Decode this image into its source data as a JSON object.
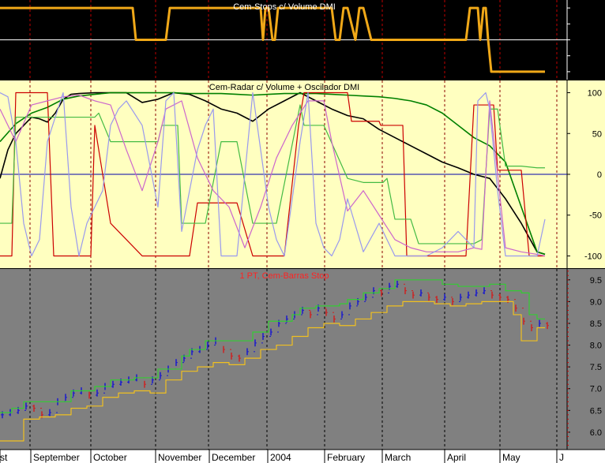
{
  "chart_data": [
    {
      "type": "line",
      "title": "Cem-Stops c/ Volume DMI",
      "ylim": [
        -1.25,
        1.25
      ],
      "yticks": [
        "1.0",
        "0.5",
        "0.0",
        "-0.5",
        "-1.0"
      ],
      "background": "#000000",
      "series": [
        {
          "color": "#f0a818",
          "x": [
            0,
            20,
            40,
            60,
            80,
            100,
            120,
            140,
            160,
            168,
            172,
            176,
            200,
            210,
            215,
            220,
            240,
            260,
            280,
            300,
            320,
            330,
            333,
            336,
            340,
            345,
            348,
            352,
            355,
            360,
            380,
            400,
            415,
            420,
            425,
            430,
            435,
            440,
            450,
            455,
            460,
            470,
            480,
            500,
            520,
            540,
            560,
            580,
            590,
            595,
            600,
            605,
            608,
            612,
            615,
            618,
            622,
            630,
            650,
            670,
            690
          ],
          "values": [
            1,
            1,
            1,
            1,
            1,
            1,
            1,
            1,
            1,
            1,
            0,
            0,
            0,
            0,
            1,
            1,
            1,
            1,
            1,
            1,
            1,
            1,
            0,
            1,
            1,
            0,
            0,
            1,
            1,
            1,
            1,
            1,
            1,
            1,
            0,
            0,
            1,
            1,
            0,
            1,
            1,
            0,
            0,
            0,
            0,
            0,
            0,
            0,
            0,
            1,
            1,
            1,
            0,
            1,
            1,
            0,
            -1,
            -1,
            -1,
            -1,
            -1
          ]
        }
      ]
    },
    {
      "type": "line",
      "title": "Cem-Radar c/ Volume + Oscilador DMI",
      "ylim": [
        -115,
        115
      ],
      "yticks": [
        "100",
        "50",
        "0",
        "-50",
        "-100"
      ],
      "background": "#ffffc0",
      "series": [
        {
          "color": "#000000",
          "x": [
            0,
            10,
            20,
            30,
            40,
            50,
            60,
            70,
            80,
            90,
            100,
            120,
            140,
            160,
            180,
            200,
            220,
            240,
            260,
            280,
            300,
            320,
            340,
            360,
            380,
            400,
            420,
            440,
            460,
            480,
            500,
            520,
            540,
            560,
            580,
            600,
            620,
            640,
            660,
            680,
            690
          ],
          "values": [
            -5,
            30,
            50,
            60,
            70,
            68,
            64,
            75,
            92,
            98,
            99,
            100,
            100,
            100,
            88,
            92,
            100,
            98,
            90,
            80,
            75,
            65,
            80,
            90,
            100,
            90,
            80,
            72,
            68,
            55,
            45,
            35,
            25,
            15,
            8,
            0,
            -5,
            -30,
            -60,
            -95,
            -98
          ]
        },
        {
          "color": "#008000",
          "x": [
            0,
            20,
            40,
            60,
            80,
            100,
            120,
            140,
            160,
            180,
            200,
            220,
            240,
            260,
            280,
            300,
            320,
            340,
            360,
            380,
            400,
            420,
            440,
            460,
            480,
            500,
            520,
            540,
            560,
            580,
            600,
            620,
            640,
            660,
            680,
            690
          ],
          "values": [
            40,
            62,
            75,
            82,
            92,
            96,
            98,
            100,
            100,
            100,
            100,
            100,
            99,
            99,
            99,
            98,
            97,
            98,
            99,
            99,
            99,
            98,
            97,
            96,
            95,
            93,
            90,
            85,
            75,
            60,
            45,
            35,
            15,
            -40,
            -95,
            -98
          ]
        },
        {
          "color": "#cc0000",
          "x": [
            0,
            15,
            20,
            60,
            68,
            115,
            120,
            140,
            180,
            200,
            240,
            250,
            268,
            300,
            320,
            340,
            360,
            378,
            385,
            440,
            445,
            480,
            482,
            510,
            515,
            590,
            600,
            625,
            630,
            660,
            670,
            690
          ],
          "values": [
            -100,
            -100,
            100,
            100,
            -100,
            -100,
            60,
            -60,
            -100,
            -100,
            -100,
            -35,
            -35,
            -35,
            -100,
            -100,
            -100,
            60,
            100,
            100,
            65,
            65,
            60,
            60,
            -100,
            -100,
            85,
            85,
            5,
            5,
            -100,
            -100
          ]
        },
        {
          "color": "#44bb44",
          "x": [
            0,
            15,
            20,
            40,
            60,
            80,
            120,
            125,
            140,
            180,
            200,
            205,
            225,
            230,
            260,
            280,
            300,
            320,
            340,
            350,
            380,
            385,
            410,
            440,
            460,
            480,
            485,
            490,
            500,
            520,
            530,
            600,
            610,
            620,
            630,
            640,
            660,
            680,
            690
          ],
          "values": [
            -60,
            -60,
            70,
            70,
            70,
            70,
            70,
            75,
            40,
            40,
            40,
            60,
            60,
            -60,
            -60,
            40,
            40,
            -60,
            -60,
            -60,
            85,
            60,
            60,
            -5,
            -10,
            -10,
            -10,
            -5,
            -55,
            -55,
            -85,
            -85,
            -80,
            80,
            80,
            10,
            10,
            8,
            8
          ]
        },
        {
          "color": "#cc66cc",
          "x": [
            0,
            10,
            20,
            40,
            60,
            80,
            100,
            120,
            140,
            160,
            180,
            200,
            210,
            230,
            250,
            270,
            290,
            310,
            330,
            350,
            370,
            390,
            410,
            420,
            440,
            460,
            480,
            500,
            520,
            540,
            560,
            580,
            600,
            610,
            620,
            630,
            640,
            660,
            680,
            690
          ],
          "values": [
            80,
            60,
            40,
            85,
            90,
            95,
            97,
            90,
            85,
            30,
            -20,
            40,
            80,
            90,
            20,
            -20,
            -40,
            -90,
            -40,
            20,
            60,
            90,
            90,
            40,
            -45,
            -20,
            -50,
            -80,
            -90,
            -95,
            -95,
            -95,
            -90,
            -92,
            90,
            0,
            -90,
            -95,
            -98,
            -100
          ]
        },
        {
          "color": "#9999ee",
          "x": [
            0,
            10,
            20,
            30,
            40,
            50,
            60,
            70,
            80,
            90,
            100,
            110,
            120,
            130,
            140,
            150,
            160,
            180,
            200,
            210,
            220,
            230,
            240,
            250,
            260,
            270,
            280,
            300,
            320,
            340,
            350,
            360,
            380,
            390,
            400,
            410,
            420,
            430,
            440,
            460,
            480,
            500,
            520,
            540,
            560,
            580,
            600,
            605,
            615,
            620,
            630,
            640,
            660,
            680,
            690
          ],
          "values": [
            100,
            95,
            40,
            -60,
            -100,
            -80,
            40,
            70,
            100,
            -40,
            -100,
            -60,
            -40,
            -20,
            60,
            80,
            90,
            60,
            -40,
            90,
            100,
            -70,
            -20,
            30,
            60,
            80,
            -100,
            -100,
            100,
            -40,
            -80,
            -100,
            40,
            100,
            -60,
            -90,
            -100,
            -80,
            -30,
            -95,
            -60,
            -100,
            -100,
            -100,
            -90,
            -70,
            -90,
            90,
            100,
            80,
            -20,
            -100,
            -100,
            -100,
            -55
          ]
        }
      ]
    },
    {
      "type": "ohlc",
      "title": "1 PT, Cem-Barras Stop",
      "ylim": [
        5.6,
        9.75
      ],
      "yticks": [
        "9.5",
        "9.0",
        "8.5",
        "8.0",
        "7.5",
        "7.0",
        "6.5",
        "6.0"
      ],
      "background": "#808080",
      "xlabels": [
        "st",
        "September",
        "October",
        "November",
        "December",
        "2004",
        "February",
        "March",
        "April",
        "May",
        "J"
      ],
      "series": [
        {
          "name": "price",
          "color": "#1a1acc",
          "down_color": "#cc2222",
          "x": [
            0,
            10,
            20,
            30,
            40,
            50,
            60,
            70,
            80,
            90,
            100,
            110,
            120,
            130,
            140,
            150,
            160,
            170,
            180,
            190,
            200,
            210,
            220,
            230,
            240,
            250,
            260,
            270,
            280,
            290,
            300,
            310,
            320,
            330,
            340,
            350,
            360,
            370,
            380,
            390,
            400,
            410,
            420,
            430,
            440,
            450,
            460,
            470,
            480,
            490,
            500,
            510,
            520,
            530,
            540,
            550,
            560,
            570,
            580,
            590,
            600,
            610,
            620,
            630,
            640,
            650,
            660,
            670,
            680,
            690
          ],
          "values": [
            6.4,
            6.45,
            6.5,
            6.6,
            6.55,
            6.4,
            6.45,
            6.7,
            6.8,
            6.9,
            6.95,
            6.85,
            6.9,
            7.05,
            7.1,
            7.15,
            7.2,
            7.25,
            7.1,
            7.2,
            7.3,
            7.45,
            7.6,
            7.7,
            7.85,
            7.9,
            8.0,
            8.1,
            7.9,
            7.75,
            7.7,
            7.85,
            8.05,
            8.2,
            8.3,
            8.5,
            8.6,
            8.7,
            8.8,
            8.7,
            8.85,
            8.75,
            8.6,
            8.7,
            8.9,
            9.0,
            9.1,
            9.25,
            9.2,
            9.35,
            9.4,
            9.25,
            9.15,
            9.2,
            9.1,
            9.05,
            9.1,
            9.0,
            9.1,
            9.15,
            9.2,
            9.25,
            9.15,
            9.1,
            9.05,
            8.85,
            8.55,
            8.4,
            8.5,
            8.45
          ]
        },
        {
          "name": "upper stop",
          "color": "#33cc33",
          "x": [
            0,
            15,
            30,
            60,
            90,
            120,
            140,
            150,
            170,
            200,
            230,
            240,
            260,
            290,
            320,
            340,
            370,
            380,
            400,
            430,
            440,
            460,
            480,
            500,
            520,
            540,
            560,
            580,
            600,
            620,
            640,
            660,
            670,
            680,
            690
          ],
          "values": [
            6.45,
            6.55,
            6.7,
            6.7,
            6.95,
            7.05,
            7.2,
            7.2,
            7.25,
            7.45,
            7.75,
            7.9,
            8.1,
            8.1,
            8.3,
            8.55,
            8.7,
            8.85,
            8.9,
            8.95,
            9.05,
            9.2,
            9.3,
            9.5,
            9.5,
            9.5,
            9.4,
            9.35,
            9.35,
            9.4,
            9.25,
            9.2,
            8.7,
            8.6,
            8.6
          ]
        },
        {
          "name": "lower stop",
          "color": "#f0c020",
          "x": [
            0,
            20,
            30,
            50,
            70,
            90,
            110,
            130,
            150,
            170,
            190,
            210,
            230,
            250,
            270,
            290,
            310,
            330,
            350,
            370,
            390,
            410,
            430,
            450,
            470,
            490,
            510,
            530,
            550,
            570,
            590,
            610,
            630,
            650,
            660,
            670,
            680,
            690
          ],
          "values": [
            5.8,
            5.8,
            6.3,
            6.35,
            6.4,
            6.55,
            6.6,
            6.8,
            6.9,
            6.95,
            6.9,
            7.2,
            7.4,
            7.5,
            7.6,
            7.55,
            7.7,
            7.9,
            8.0,
            8.2,
            8.4,
            8.5,
            8.45,
            8.6,
            8.75,
            8.9,
            9.0,
            9.0,
            8.95,
            8.9,
            8.95,
            9.0,
            9.0,
            8.7,
            8.1,
            8.1,
            8.4,
            8.4
          ]
        }
      ]
    }
  ]
}
